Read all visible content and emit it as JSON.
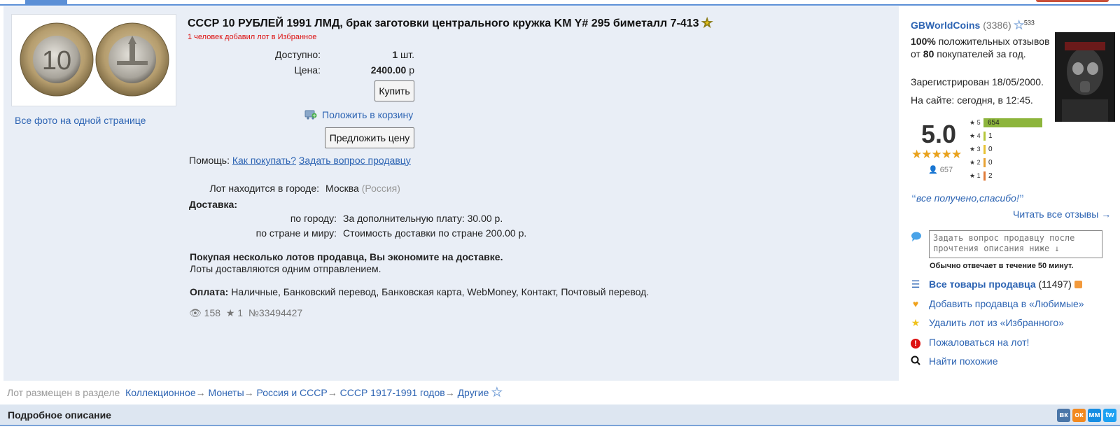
{
  "lot": {
    "title": "СССР 10 РУБЛЕЙ 1991 ЛМД, брак заготовки центрального кружка KM Y# 295 биметалл 7-413",
    "favorites_note": "1 человек добавил лот в Избранное",
    "all_photos_link": "Все фото на одной странице",
    "available_label": "Доступно:",
    "available_value": "1",
    "available_unit": " шт.",
    "price_label": "Цена:",
    "price_value": "2400.00",
    "price_unit": " р",
    "buy_button": "Купить",
    "cart_link": "Положить в корзину",
    "offer_button": "Предложить цену",
    "help_label": "Помощь:",
    "help_how_to_buy": "Как покупать?",
    "help_ask_seller": "Задать вопрос продавцу",
    "city_label": "Лот находится в городе:",
    "city_value": "Москва",
    "city_country": "(Россия)",
    "delivery_heading": "Доставка:",
    "delivery_city_label": "по городу:",
    "delivery_city_value": "За дополнительную плату: 30.00 р.",
    "delivery_world_label": "по стране и миру:",
    "delivery_world_value": "Стоимость доставки по стране 200.00 р.",
    "save_heading": "Покупая несколько лотов продавца, Вы экономите на доставке.",
    "save_text": "Лоты доставляются одним отправлением.",
    "payment_label": "Оплата:",
    "payment_value": "Наличные, Банковский перевод, Банковская карта, WebMoney, Контакт, Почтовый перевод.",
    "views": "158",
    "stars": "1",
    "lot_number": "№33494427"
  },
  "seller": {
    "name": "GBWorldCoins",
    "rating_count": "(3386)",
    "star_badge": "533",
    "positive_percent": "100%",
    "positive_text_1": " положительных отзывов от ",
    "positive_buyers": "80",
    "positive_text_2": " покупателей за год.",
    "registered": "Зарегистрирован 18/05/2000.",
    "online": "На сайте: сегодня, в 12:45.",
    "score": "5.0",
    "reviewers": "657",
    "distribution": [
      {
        "label": "★ 5",
        "value": 654,
        "text": "654",
        "color": "#8db53c"
      },
      {
        "label": "★ 4",
        "value": 1,
        "text": "1",
        "color": "#b5c73a"
      },
      {
        "label": "★ 3",
        "value": 0,
        "text": "0",
        "color": "#e8c234"
      },
      {
        "label": "★ 2",
        "value": 0,
        "text": "0",
        "color": "#e8a234"
      },
      {
        "label": "★ 1",
        "value": 2,
        "text": "2",
        "color": "#e07b39"
      }
    ],
    "quote": "все получено,спасибо!",
    "read_all_reviews": "Читать все отзывы →",
    "question_placeholder": "Задать вопрос продавцу после прочтения описания ниже ↓",
    "response_time": "Обычно отвечает в течение 50 минут.",
    "all_items": "Все товары продавца",
    "all_items_count": " (11497)",
    "add_favorite_seller": "Добавить продавца в «Любимые»",
    "remove_from_favorites": "Удалить лот из «Избранного»",
    "report_lot": "Пожаловаться на лот!",
    "find_similar": "Найти похожие"
  },
  "breadcrumb": {
    "label": "Лот размещен в разделе",
    "items": [
      "Коллекционное",
      "Монеты",
      "Россия и СССР",
      "СССР 1917-1991 годов",
      "Другие"
    ],
    "separator": "→"
  },
  "description_heading": "Подробное описание",
  "social": [
    "вк",
    "ок",
    "мм",
    "tw"
  ],
  "colors": {
    "accent": "#2d64b3",
    "panel": "#e9eef6",
    "alert_red": "#dd1111"
  }
}
